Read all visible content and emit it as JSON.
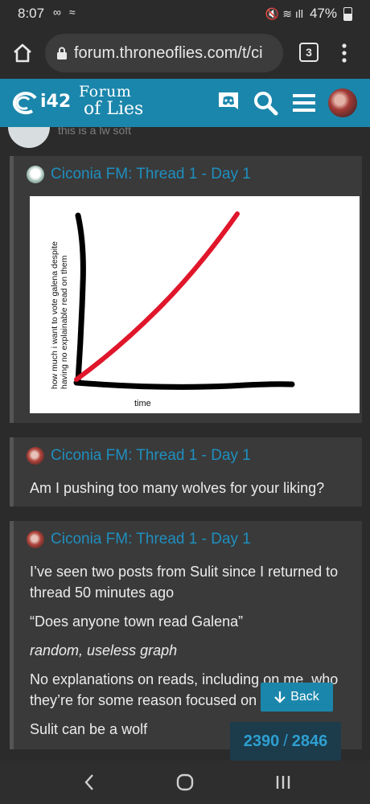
{
  "status": {
    "time": "8:07",
    "left_icons": "∞ ≈",
    "right_icons": "🔇 ≋ ıll",
    "battery": "47%",
    "battery_level": 0.47
  },
  "browser": {
    "url": "forum.throneoflies.com/t/ci",
    "tab_count": "3"
  },
  "header": {
    "logo_i42": "i42",
    "logo_line1": "Forum",
    "logo_line2": "of Lies"
  },
  "previous_post": {
    "snippet": "this is a lw soft"
  },
  "posts": [
    {
      "quote_title": "Ciconia FM: Thread 1 - Day 1",
      "graph": {
        "ylabel_line1": "how much i want to vote galena despite",
        "ylabel_line2": "having no explainable read on them",
        "xlabel": "time"
      }
    },
    {
      "quote_title": "Ciconia FM: Thread 1 - Day 1",
      "paragraphs": [
        "Am I pushing too many wolves for your liking?"
      ]
    },
    {
      "quote_title": "Ciconia FM: Thread 1 - Day 1",
      "paragraphs": [
        "I’ve seen two posts from Sulit since I returned to",
        "thread 50 minutes ago",
        "“Does anyone town read Galena”",
        "random, useless graph",
        "No explanations on reads, including on me, who",
        "they’re for some reason focused on",
        "Sulit can be a wolf"
      ]
    }
  ],
  "back_button": {
    "label": "Back"
  },
  "progress": {
    "current": "2390",
    "separator": "/",
    "total": "2846"
  },
  "colors": {
    "accent": "#1b86ab",
    "link": "#1f8fbf",
    "graph_line": "#e0162b"
  }
}
